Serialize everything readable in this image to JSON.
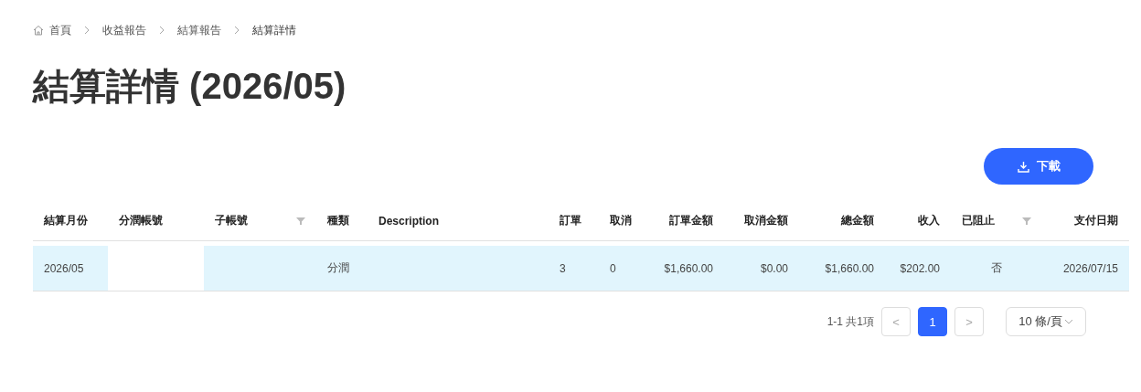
{
  "breadcrumb": [
    {
      "label": "首頁",
      "kind": "home"
    },
    {
      "label": "收益報告",
      "kind": "link"
    },
    {
      "label": "結算報告",
      "kind": "link"
    },
    {
      "label": "結算詳情",
      "kind": "current"
    }
  ],
  "title": "結算詳情 (2026/05)",
  "download_button": "下載",
  "table": {
    "columns": [
      {
        "label": "結算月份",
        "filter": false
      },
      {
        "label": "分潤帳號",
        "filter": false
      },
      {
        "label": "子帳號",
        "filter": true
      },
      {
        "label": "種類",
        "filter": false
      },
      {
        "label": "Description",
        "filter": false
      },
      {
        "label": "訂單",
        "filter": false
      },
      {
        "label": "取消",
        "filter": false
      },
      {
        "label": "訂單金額",
        "filter": false
      },
      {
        "label": "取消金額",
        "filter": false
      },
      {
        "label": "總金額",
        "filter": false
      },
      {
        "label": "收入",
        "filter": false
      },
      {
        "label": "已阻止",
        "filter": true
      },
      {
        "label": "支付日期",
        "filter": false
      }
    ],
    "rows": [
      {
        "selected": true,
        "cells": [
          "2026/05",
          "",
          "",
          "分潤",
          "",
          "3",
          "0",
          "$1,660.00",
          "$0.00",
          "$1,660.00",
          "$202.00",
          "否",
          "2026/07/15"
        ]
      }
    ]
  },
  "pagination": {
    "summary": "1-1 共1項",
    "prev": "<",
    "pages": [
      {
        "label": "1",
        "selected": true
      }
    ],
    "next": ">",
    "page_size": "10 條/頁"
  }
}
